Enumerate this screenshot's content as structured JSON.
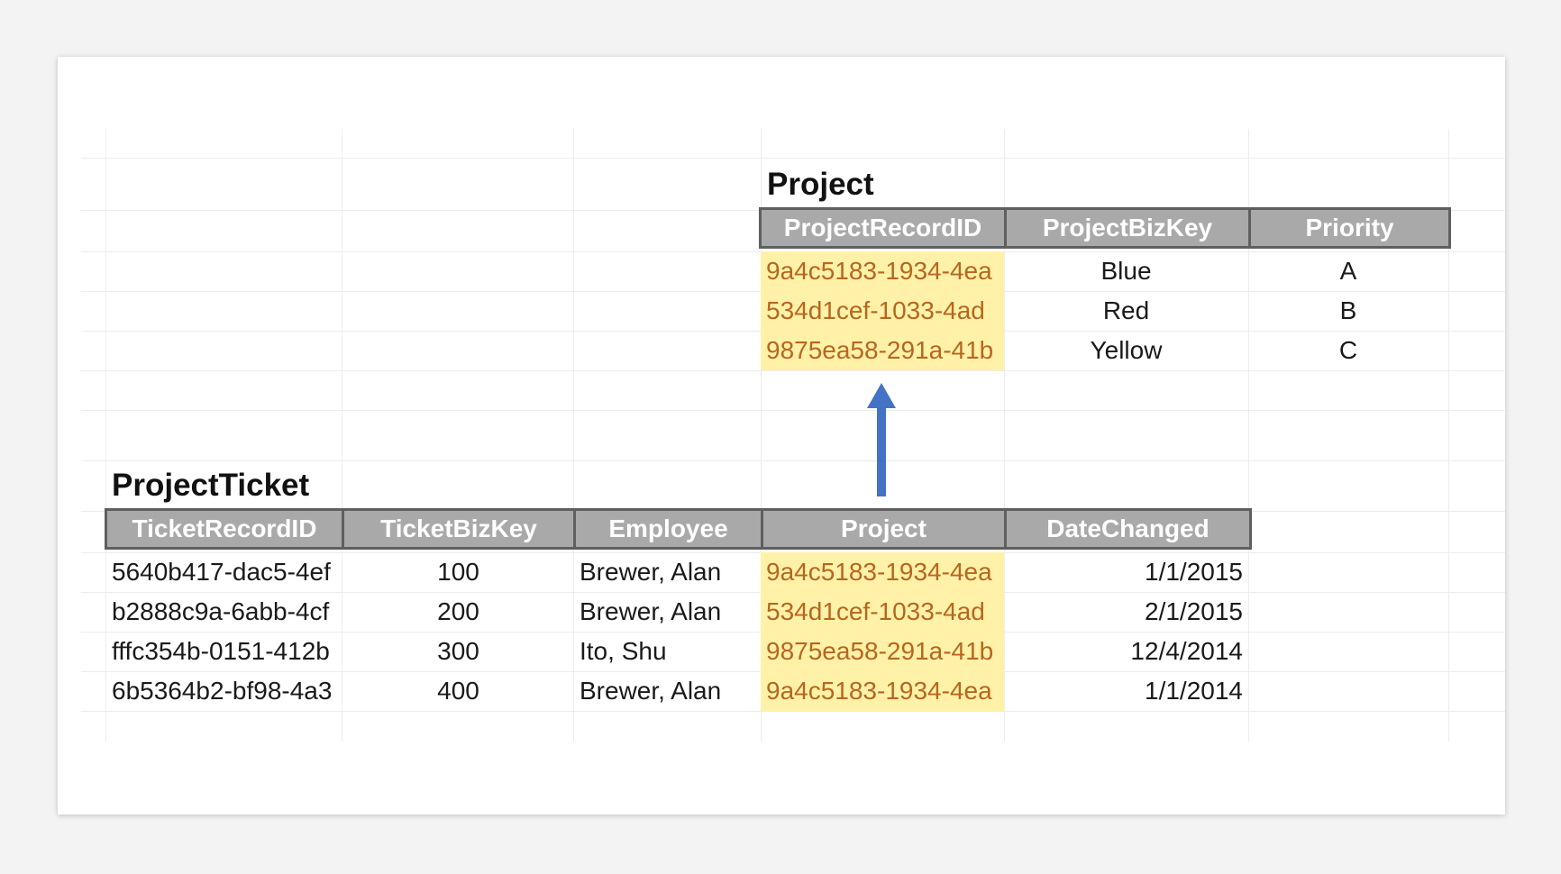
{
  "project_table": {
    "title": "Project",
    "columns": [
      "ProjectRecordID",
      "ProjectBizKey",
      "Priority"
    ],
    "rows": [
      [
        "9a4c5183-1934-4ea",
        "Blue",
        "A"
      ],
      [
        "534d1cef-1033-4ad",
        "Red",
        "B"
      ],
      [
        "9875ea58-291a-41b",
        "Yellow",
        "C"
      ]
    ]
  },
  "ticket_table": {
    "title": "ProjectTicket",
    "columns": [
      "TicketRecordID",
      "TicketBizKey",
      "Employee",
      "Project",
      "DateChanged"
    ],
    "rows": [
      [
        "5640b417-dac5-4ef",
        "100",
        "Brewer, Alan",
        "9a4c5183-1934-4ea",
        "1/1/2015"
      ],
      [
        "b2888c9a-6abb-4cf",
        "200",
        "Brewer, Alan",
        "534d1cef-1033-4ad",
        "2/1/2015"
      ],
      [
        "fffc354b-0151-412b",
        "300",
        "Ito, Shu",
        "9875ea58-291a-41b",
        "12/4/2014"
      ],
      [
        "6b5364b2-bf98-4a3",
        "400",
        "Brewer, Alan",
        "9a4c5183-1934-4ea",
        "1/1/2014"
      ]
    ]
  },
  "colors": {
    "highlight_fill": "#fff2a8",
    "highlight_text": "#b8661e",
    "header_fill": "#a9a9a9",
    "header_border": "#5f5f5f",
    "arrow": "#4472c4"
  },
  "icons": {
    "arrow": "up-arrow-icon"
  }
}
